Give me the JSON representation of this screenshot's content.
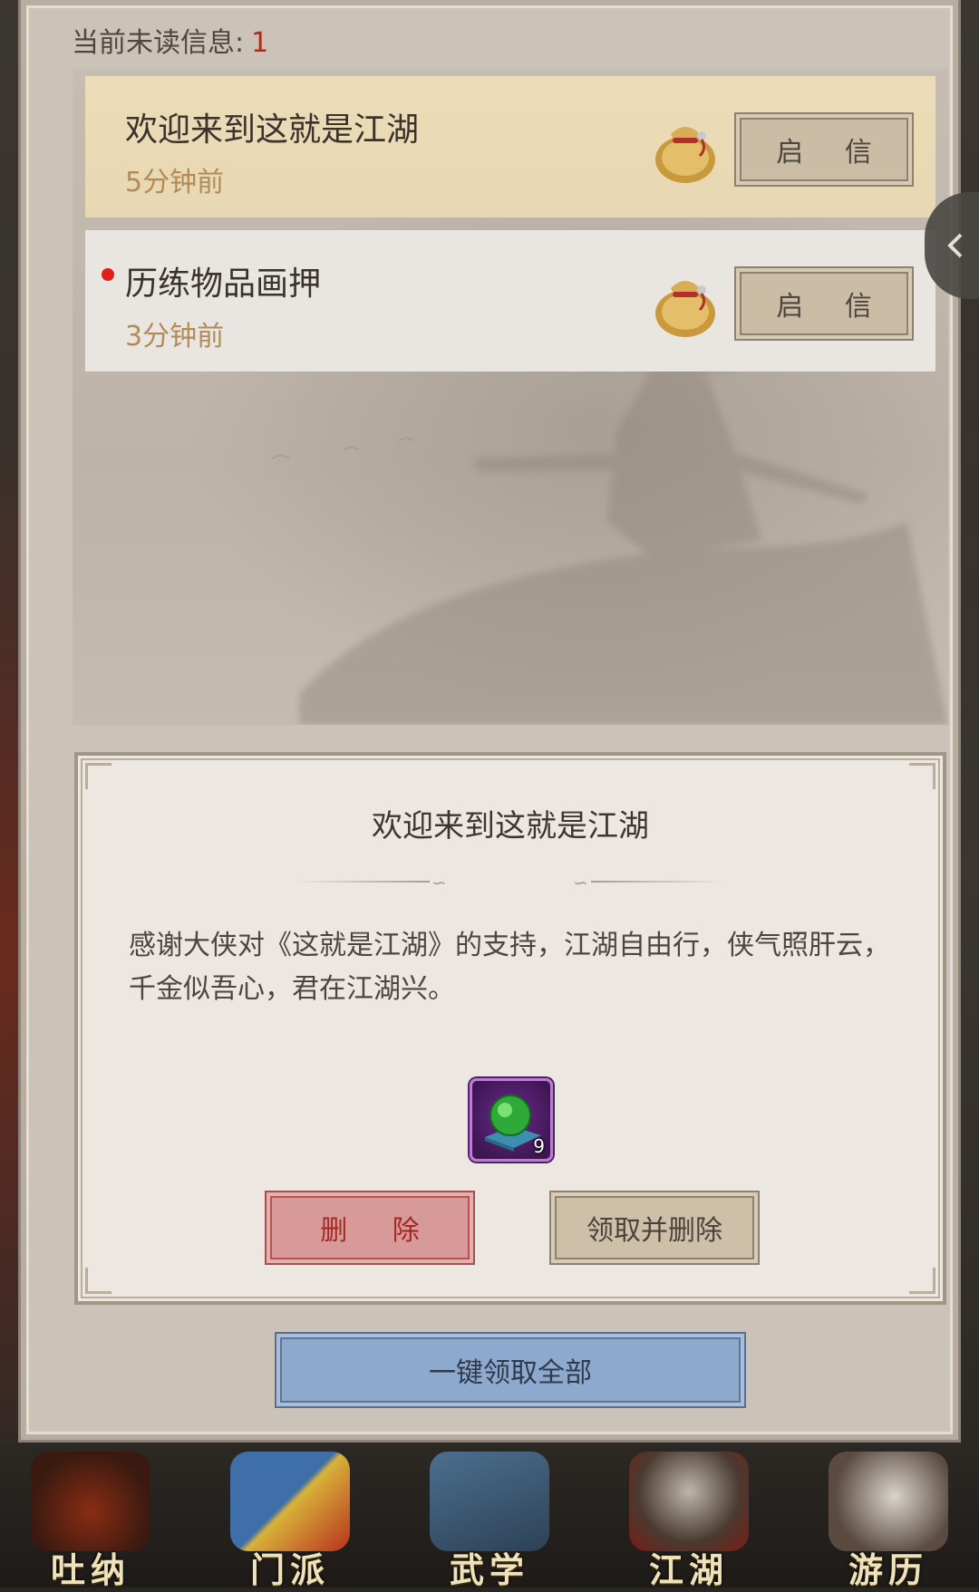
{
  "header": {
    "unread_label": "当前未读信息:",
    "unread_count": "1"
  },
  "mail_list": [
    {
      "title": "欢迎来到这就是江湖",
      "time": "5分钟前",
      "button": "启 信",
      "unread": false
    },
    {
      "title": "历练物品画押",
      "time": "3分钟前",
      "button": "启 信",
      "unread": true
    }
  ],
  "detail": {
    "title": "欢迎来到这就是江湖",
    "body": "感谢大侠对《这就是江湖》的支持，江湖自由行，侠气照肝云，千金似吾心，君在江湖兴。",
    "reward_count": "9",
    "delete_label": "删 除",
    "claim_delete_label": "领取并删除"
  },
  "claim_all_label": "一键领取全部",
  "bottom_nav": [
    {
      "label": "吐纳",
      "icon": "meditation-icon"
    },
    {
      "label": "门派",
      "icon": "sect-banner-icon"
    },
    {
      "label": "武学",
      "icon": "martial-book-icon"
    },
    {
      "label": "江湖",
      "icon": "bamboo-hat-icon"
    },
    {
      "label": "游历",
      "icon": "horse-icon"
    }
  ],
  "colors": {
    "panel_bg": "#cbc2b8",
    "read_item_bg": "#ecdcb8",
    "unread_item_bg": "#e9e6e2",
    "unread_dot": "#e21f16",
    "delete_button": "#d89a98",
    "claim_all_button": "#8ea9ce",
    "reward_frame": "#c07ad8"
  }
}
